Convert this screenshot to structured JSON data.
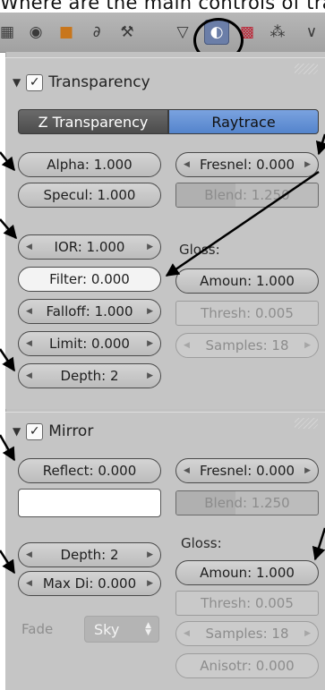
{
  "caption": "Where are the main controls of transparency",
  "toolbar": {
    "icons": [
      "render-layers-icon",
      "world-icon",
      "object-icon",
      "constraints-icon",
      "modifiers-icon",
      "object-data-icon",
      "material-icon",
      "texture-icon",
      "particles-icon",
      "physics-icon"
    ],
    "active": "material-icon"
  },
  "transparency": {
    "title": "Transparency",
    "enabled": "✓",
    "mode_ztransparency": "Z Transparency",
    "mode_raytrace": "Raytrace",
    "alpha": "Alpha: 1.000",
    "specular": "Specul: 1.000",
    "fresnel": "Fresnel: 0.000",
    "blend": "Blend: 1.250",
    "ior": "IOR: 1.000",
    "filter": "Filter: 0.000",
    "falloff": "Falloff: 1.000",
    "limit": "Limit: 0.000",
    "depth": "Depth: 2",
    "gloss_label": "Gloss:",
    "gloss_amount": "Amoun: 1.000",
    "gloss_threshold": "Thresh: 0.005",
    "gloss_samples": "Samples: 18"
  },
  "mirror": {
    "title": "Mirror",
    "enabled": "✓",
    "reflect": "Reflect: 0.000",
    "fresnel": "Fresnel: 0.000",
    "blend": "Blend: 1.250",
    "depth": "Depth: 2",
    "max_distance": "Max Di: 0.000",
    "fade_label": "Fade",
    "fade_value": "Sky",
    "gloss_label": "Gloss:",
    "gloss_amount": "Amoun: 1.000",
    "gloss_threshold": "Thresh: 0.005",
    "gloss_samples": "Samples: 18",
    "gloss_anisotropy": "Anisotr: 0.000"
  },
  "colors": {
    "panel": "#c5c5c5",
    "toolbar": "#a8a8a8",
    "raytrace_active": "#6a93d6",
    "ztransp_inactive": "#575757",
    "mirror_color": "#ffffff"
  }
}
